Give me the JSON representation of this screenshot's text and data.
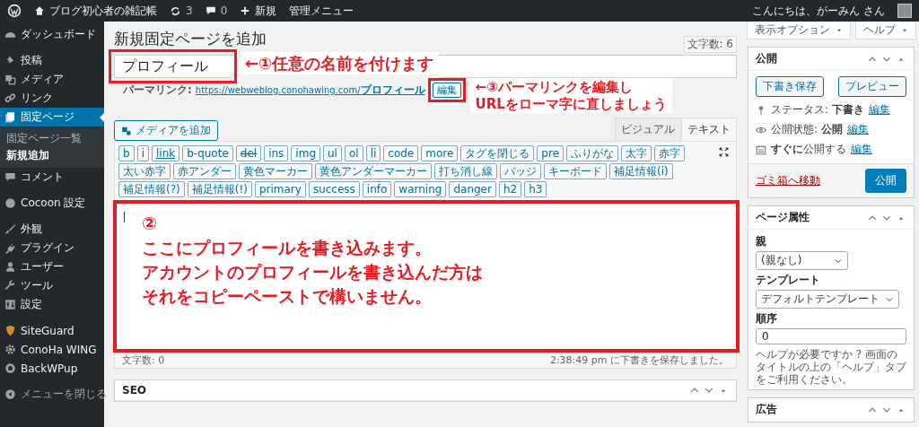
{
  "admin_bar": {
    "site_name": "ブログ初心者の雑記帳",
    "updates": "3",
    "comments": "0",
    "new_label": "新規",
    "admin_menu": "管理メニュー",
    "greeting": "こんにちは、がーみん さん"
  },
  "sidebar": {
    "groups": [
      [
        {
          "label": "ダッシュボード",
          "selected": false
        }
      ],
      [
        {
          "label": "投稿",
          "selected": false
        },
        {
          "label": "メディア",
          "selected": false
        },
        {
          "label": "リンク",
          "selected": false
        },
        {
          "label": "固定ページ",
          "selected": true,
          "submenu": [
            {
              "label": "固定ページ一覧",
              "selected": false
            },
            {
              "label": "新規追加",
              "selected": true
            }
          ]
        },
        {
          "label": "コメント",
          "selected": false
        }
      ],
      [
        {
          "label": "Cocoon 設定",
          "selected": false
        }
      ],
      [
        {
          "label": "外観",
          "selected": false
        },
        {
          "label": "プラグイン",
          "selected": false
        },
        {
          "label": "ユーザー",
          "selected": false
        },
        {
          "label": "ツール",
          "selected": false
        },
        {
          "label": "設定",
          "selected": false
        }
      ],
      [
        {
          "label": "SiteGuard",
          "selected": false
        },
        {
          "label": "ConoHa WING",
          "selected": false
        },
        {
          "label": "BackWPup",
          "selected": false
        }
      ]
    ],
    "collapse": "メニューを閉じる"
  },
  "screen_tabs": [
    "表示オプション",
    "ヘルプ"
  ],
  "page_title": "新規固定ページを追加",
  "title_count": "文字数: 6",
  "title_field": {
    "value": "プロフィール"
  },
  "permalink": {
    "label": "パーマリンク:",
    "url": "https://webweblog.conohawing.com/**プロフィール**",
    "edit_button": "編集"
  },
  "media_button": "メディアを追加",
  "editor_tabs": [
    {
      "label": "ビジュアル",
      "selected": false
    },
    {
      "label": "テキスト",
      "selected": true
    }
  ],
  "quicktags": [
    {
      "label": "b",
      "kind": "plain"
    },
    {
      "label": "i",
      "kind": "plain"
    },
    {
      "label": "link",
      "kind": "link"
    },
    {
      "label": "b-quote",
      "kind": "plain"
    },
    {
      "label": "del",
      "kind": "del"
    },
    {
      "label": "ins",
      "kind": "plain"
    },
    {
      "label": "img",
      "kind": "plain"
    },
    {
      "label": "ul",
      "kind": "plain"
    },
    {
      "label": "ol",
      "kind": "plain"
    },
    {
      "label": "li",
      "kind": "plain"
    },
    {
      "label": "code",
      "kind": "plain"
    },
    {
      "label": "more",
      "kind": "plain"
    },
    {
      "label": "タグを閉じる",
      "kind": "plain"
    },
    {
      "label": "pre",
      "kind": "plain"
    },
    {
      "label": "ふりがな",
      "kind": "plain"
    },
    {
      "label": "太字",
      "kind": "plain"
    },
    {
      "label": "赤字",
      "kind": "plain"
    },
    {
      "label": "太い赤字",
      "kind": "plain"
    },
    {
      "label": "赤アンダー",
      "kind": "plain"
    },
    {
      "label": "黄色マーカー",
      "kind": "plain"
    },
    {
      "label": "黄色アンダーマーカー",
      "kind": "plain"
    },
    {
      "label": "打ち消し線",
      "kind": "plain"
    },
    {
      "label": "バッジ",
      "kind": "plain"
    },
    {
      "label": "キーボード",
      "kind": "plain"
    },
    {
      "label": "補足情報(i)",
      "kind": "plain"
    },
    {
      "label": "補足情報(?)",
      "kind": "plain"
    },
    {
      "label": "補足情報(!)",
      "kind": "plain"
    },
    {
      "label": "primary",
      "kind": "plain"
    },
    {
      "label": "success",
      "kind": "plain"
    },
    {
      "label": "info",
      "kind": "plain"
    },
    {
      "label": "warning",
      "kind": "plain"
    },
    {
      "label": "danger",
      "kind": "plain"
    },
    {
      "label": "h2",
      "kind": "plain"
    },
    {
      "label": "h3",
      "kind": "plain"
    }
  ],
  "editor": {
    "footer_count": "文字数: 0",
    "autosave": "2:38:49 pm に下書きを保存しました。"
  },
  "seo_panel": {
    "title": "SEO"
  },
  "publish_box": {
    "title": "公開",
    "save_draft": "下書き保存",
    "preview": "プレビュー",
    "rows": [
      {
        "text": "ステータス: **下書き**",
        "link": "編集"
      },
      {
        "text": "公開状態: **公開**",
        "link": "編集"
      },
      {
        "text": "**すぐに**公開する",
        "link": "編集"
      }
    ],
    "trash": "ゴミ箱へ移動",
    "publish": "公開"
  },
  "page_attributes": {
    "title": "ページ属性",
    "parent_label": "親",
    "parent_value": "(親なし)",
    "template_label": "テンプレート",
    "template_value": "デフォルトテンプレート",
    "order_label": "順序",
    "order_value": "0",
    "help": "ヘルプが必要ですか ? 画面のタイトルの上の「ヘルプ」タブをご利用ください。"
  },
  "ad_panel": {
    "title": "広告"
  },
  "annotations": {
    "title": "←①任意の名前を付けます",
    "permalink": [
      "←③パーマリンクを編集し",
      "URLをローマ字に直しましょう"
    ],
    "editor": {
      "number": "②",
      "lines": [
        "ここにプロフィールを書き込みます。",
        "アカウントのプロフィールを書き込んだ方は",
        "それをコピーペーストで構いません。"
      ]
    }
  }
}
